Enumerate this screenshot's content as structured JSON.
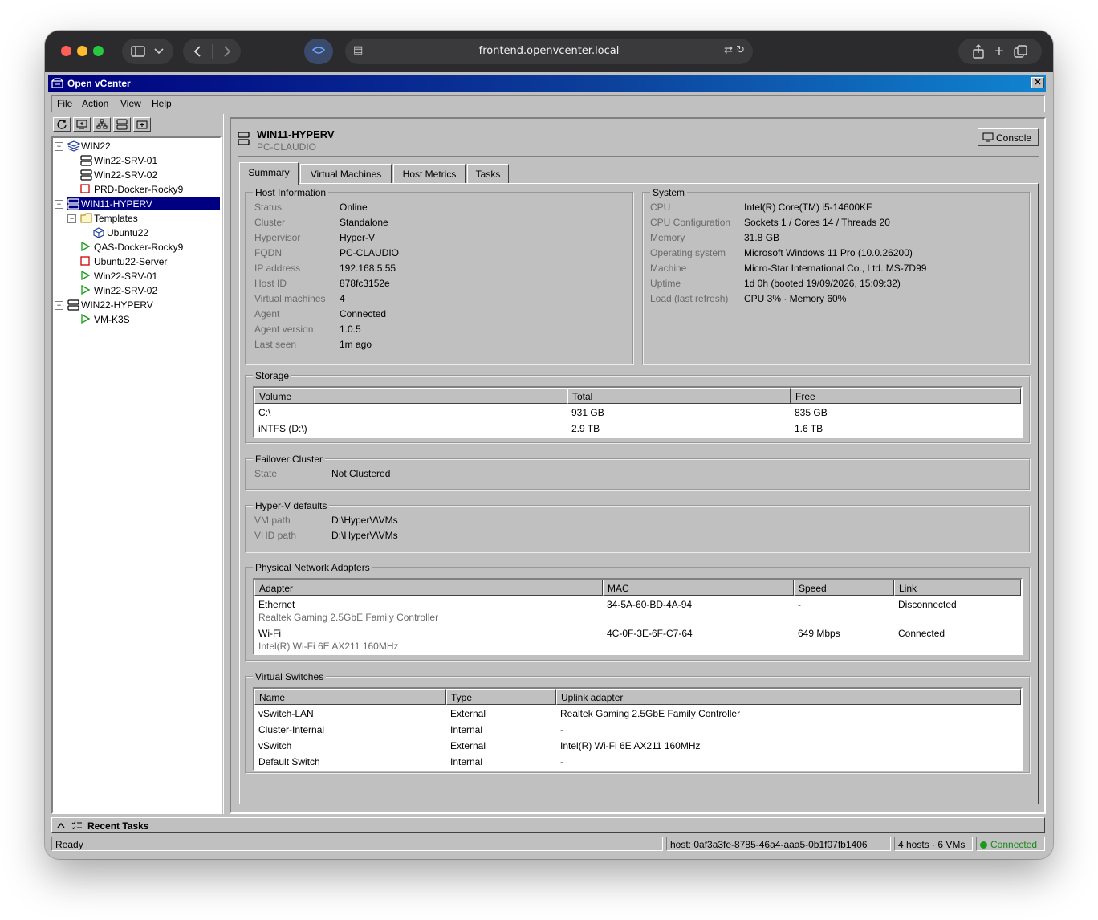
{
  "browser": {
    "url": "frontend.openvcenter.local"
  },
  "app": {
    "title": "Open vCenter",
    "close_glyph": "✕"
  },
  "menu": {
    "items": [
      "File",
      "Action",
      "View",
      "Help"
    ]
  },
  "toolbar": {
    "icons": [
      "refresh-icon",
      "add-host-icon",
      "cluster-icon",
      "server-icon",
      "new-folder-icon"
    ]
  },
  "tree": {
    "nodes": [
      {
        "label": "WIN22",
        "icon": "cluster-icon",
        "expander": "−"
      },
      {
        "label": "Win22-SRV-01",
        "icon": "server-icon"
      },
      {
        "label": "Win22-SRV-02",
        "icon": "server-icon"
      },
      {
        "label": "PRD-Docker-Rocky9",
        "icon": "vm-stopped-icon"
      },
      {
        "label": "WIN11-HYPERV",
        "icon": "server-icon",
        "expander": "−",
        "selected": true
      },
      {
        "label": "Templates",
        "icon": "folder-icon",
        "expander": "−"
      },
      {
        "label": "Ubuntu22",
        "icon": "template-icon"
      },
      {
        "label": "QAS-Docker-Rocky9",
        "icon": "vm-running-icon"
      },
      {
        "label": "Ubuntu22-Server",
        "icon": "vm-stopped-icon"
      },
      {
        "label": "Win22-SRV-01",
        "icon": "vm-running-icon"
      },
      {
        "label": "Win22-SRV-02",
        "icon": "vm-running-icon"
      },
      {
        "label": "WIN22-HYPERV",
        "icon": "server-icon",
        "expander": "−"
      },
      {
        "label": "VM-K3S",
        "icon": "vm-running-icon"
      }
    ]
  },
  "host": {
    "name": "WIN11-HYPERV",
    "subtitle": "PC-CLAUDIO",
    "console_label": "Console"
  },
  "tabs": [
    {
      "label": "Summary",
      "active": true
    },
    {
      "label": "Virtual Machines"
    },
    {
      "label": "Host Metrics"
    },
    {
      "label": "Tasks"
    }
  ],
  "host_info": {
    "title": "Host Information",
    "rows": [
      {
        "k": "Status",
        "v": "Online"
      },
      {
        "k": "Cluster",
        "v": "Standalone"
      },
      {
        "k": "Hypervisor",
        "v": "Hyper-V"
      },
      {
        "k": "FQDN",
        "v": "PC-CLAUDIO"
      },
      {
        "k": "IP address",
        "v": "192.168.5.55"
      },
      {
        "k": "Host ID",
        "v": "878fc3152e"
      },
      {
        "k": "Virtual machines",
        "v": "4"
      },
      {
        "k": "Agent",
        "v": "Connected"
      },
      {
        "k": "Agent version",
        "v": "1.0.5"
      },
      {
        "k": "Last seen",
        "v": "1m ago"
      }
    ]
  },
  "system": {
    "title": "System",
    "rows": [
      {
        "k": "CPU",
        "v": "Intel(R) Core(TM) i5-14600KF"
      },
      {
        "k": "CPU Configuration",
        "v": "Sockets 1 / Cores 14 / Threads 20"
      },
      {
        "k": "Memory",
        "v": "31.8 GB"
      },
      {
        "k": "Operating system",
        "v": "Microsoft Windows 11 Pro (10.0.26200)"
      },
      {
        "k": "Machine",
        "v": "Micro-Star International Co., Ltd. MS-7D99"
      },
      {
        "k": "Uptime",
        "v": "1d 0h (booted 19/09/2026, 15:09:32)"
      },
      {
        "k": "Load (last refresh)",
        "v": "CPU 3% · Memory 60%"
      }
    ]
  },
  "storage": {
    "title": "Storage",
    "columns": [
      "Volume",
      "Total",
      "Free"
    ],
    "rows": [
      [
        "C:\\",
        "931 GB",
        "835 GB"
      ],
      [
        "iNTFS (D:\\)",
        "2.9 TB",
        "1.6 TB"
      ]
    ]
  },
  "failover": {
    "title": "Failover Cluster",
    "rows": [
      {
        "k": "State",
        "v": "Not Clustered"
      }
    ]
  },
  "hyperv_defaults": {
    "title": "Hyper-V defaults",
    "rows": [
      {
        "k": "VM path",
        "v": "D:\\HyperV\\VMs"
      },
      {
        "k": "VHD path",
        "v": "D:\\HyperV\\VMs"
      }
    ]
  },
  "network_adapters": {
    "title": "Physical Network Adapters",
    "columns": [
      "Adapter",
      "MAC",
      "Speed",
      "Link"
    ],
    "rows": [
      {
        "name": "Ethernet",
        "desc": "Realtek Gaming 2.5GbE Family Controller",
        "mac": "34-5A-60-BD-4A-94",
        "speed": "-",
        "link": "Disconnected"
      },
      {
        "name": "Wi-Fi",
        "desc": "Intel(R) Wi-Fi 6E AX211 160MHz",
        "mac": "4C-0F-3E-6F-C7-64",
        "speed": "649 Mbps",
        "link": "Connected"
      }
    ]
  },
  "virtual_switches": {
    "title": "Virtual Switches",
    "columns": [
      "Name",
      "Type",
      "Uplink adapter"
    ],
    "rows": [
      [
        "vSwitch-LAN",
        "External",
        "Realtek Gaming 2.5GbE Family Controller"
      ],
      [
        "Cluster-Internal",
        "Internal",
        "-"
      ],
      [
        "vSwitch",
        "External",
        "Intel(R) Wi-Fi 6E AX211 160MHz"
      ],
      [
        "Default Switch",
        "Internal",
        "-"
      ]
    ]
  },
  "recent_tasks": {
    "label": "Recent Tasks"
  },
  "status": {
    "left": "Ready",
    "host": "host: 0af3a3fe-8785-46a4-aaa5-0b1f07fb1406",
    "counts": "4 hosts · 6 VMs",
    "connection": "Connected",
    "connection_color": "#1a8a1a"
  },
  "colors": {
    "accent": "#000080",
    "chrome": "#c0c0c0",
    "running": "#1a9a1a",
    "stopped": "#cc0000"
  }
}
